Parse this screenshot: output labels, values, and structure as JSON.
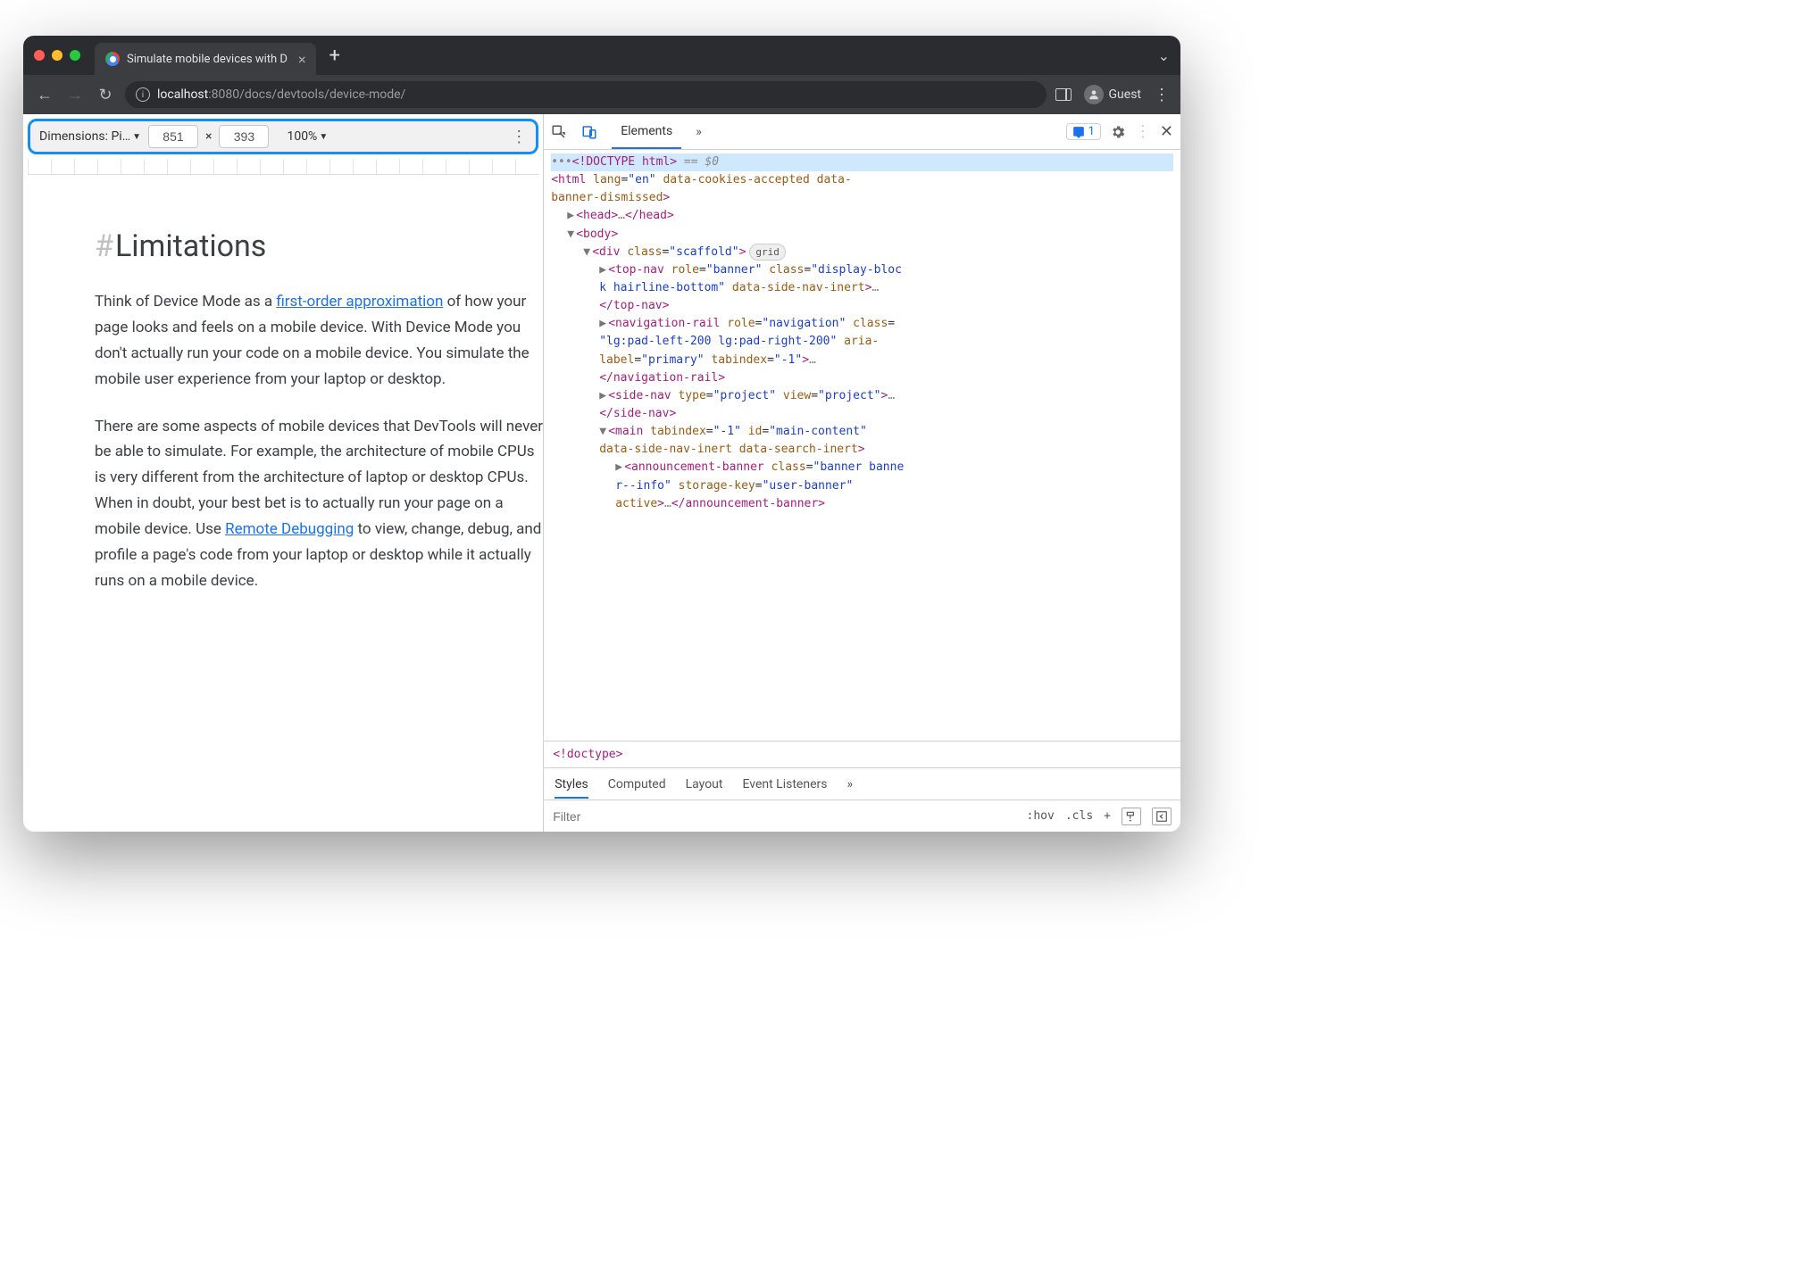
{
  "browser": {
    "tab_title": "Simulate mobile devices with D",
    "close_x": "×",
    "new_tab": "+",
    "chevron": "⌄"
  },
  "toolbar": {
    "back": "←",
    "forward": "→",
    "reload": "↻",
    "url_host": "localhost",
    "url_port": ":8080",
    "url_path": "/docs/devtools/device-mode/",
    "guest": "Guest",
    "more": "⋮"
  },
  "device_toolbar": {
    "dimensions_label": "Dimensions: Pi…",
    "width": "851",
    "times": "×",
    "height": "393",
    "zoom": "100%",
    "more": "⋮"
  },
  "page": {
    "hash": "#",
    "heading": "Limitations",
    "p1_a": "Think of Device Mode as a ",
    "p1_link": "first-order approximation",
    "p1_b": " of how your page looks and feels on a mobile device. With Device Mode you don't actually run your code on a mobile device. You simulate the mobile user experience from your laptop or desktop.",
    "p2_a": "There are some aspects of mobile devices that DevTools will never be able to simulate. For example, the architecture of mobile CPUs is very different from the architecture of laptop or desktop CPUs. When in doubt, your best bet is to actually run your page on a mobile device. Use ",
    "p2_link": "Remote Debugging",
    "p2_b": " to view, change, debug, and profile a page's code from your laptop or desktop while it actually runs on a mobile device."
  },
  "devtools": {
    "tab_elements": "Elements",
    "more_tabs": "»",
    "issues_count": "1",
    "close": "✕",
    "breadcrumb": "<!doctype>",
    "styles_tabs": {
      "styles": "Styles",
      "computed": "Computed",
      "layout": "Layout",
      "event_listeners": "Event Listeners",
      "more": "»"
    },
    "filter_placeholder": "Filter",
    "hov": ":hov",
    "cls": ".cls",
    "plus": "+"
  },
  "dom": {
    "doctype": "<!DOCTYPE html>",
    "sel0": " == $0",
    "html_open": "<html lang=\"en\" data-cookies-accepted data-banner-dismissed>",
    "head": "<head>…</head>",
    "body_open": "<body>",
    "div_open": "<div class=\"scaffold\">",
    "grid_badge": "grid",
    "topnav": "<top-nav role=\"banner\" class=\"display-block hairline-bottom\" data-side-nav-inert>…</top-nav>",
    "navrail": "<navigation-rail role=\"navigation\" class=\"lg:pad-left-200 lg:pad-right-200\" aria-label=\"primary\" tabindex=\"-1\">…</navigation-rail>",
    "sidenav": "<side-nav type=\"project\" view=\"project\">…</side-nav>",
    "main_open": "<main tabindex=\"-1\" id=\"main-content\" data-side-nav-inert data-search-inert>",
    "announce": "<announcement-banner class=\"banner banner--info\" storage-key=\"user-banner\" active>…</announcement-banner>"
  }
}
